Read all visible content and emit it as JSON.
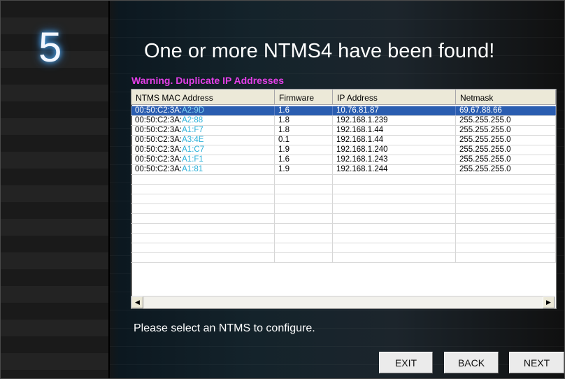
{
  "step": {
    "number": "5"
  },
  "header": {
    "title": "One or more NTMS4 have been found!",
    "warning": "Warning. Duplicate IP Addresses"
  },
  "device_list": {
    "columns": [
      "NTMS MAC Address",
      "Firmware",
      "IP Address",
      "Netmask"
    ],
    "rows": [
      {
        "mac_prefix": "00:50:C2:3A:",
        "mac_suffix": "A2:9D",
        "firmware": "1.6",
        "ip": "10.76.81.87",
        "netmask": "69.67.88.66",
        "selected": true
      },
      {
        "mac_prefix": "00:50:C2:3A:",
        "mac_suffix": "A2:88",
        "firmware": "1.8",
        "ip": "192.168.1.239",
        "netmask": "255.255.255.0",
        "selected": false
      },
      {
        "mac_prefix": "00:50:C2:3A:",
        "mac_suffix": "A1:F7",
        "firmware": "1.8",
        "ip": "192.168.1.44",
        "netmask": "255.255.255.0",
        "selected": false
      },
      {
        "mac_prefix": "00:50:C2:3A:",
        "mac_suffix": "A3:4E",
        "firmware": "0.1",
        "ip": "192.168.1.44",
        "netmask": "255.255.255.0",
        "selected": false
      },
      {
        "mac_prefix": "00:50:C2:3A:",
        "mac_suffix": "A1:C7",
        "firmware": "1.9",
        "ip": "192.168.1.240",
        "netmask": "255.255.255.0",
        "selected": false
      },
      {
        "mac_prefix": "00:50:C2:3A:",
        "mac_suffix": "A1:F1",
        "firmware": "1.6",
        "ip": "192.168.1.243",
        "netmask": "255.255.255.0",
        "selected": false
      },
      {
        "mac_prefix": "00:50:C2:3A:",
        "mac_suffix": "A1:81",
        "firmware": "1.9",
        "ip": "192.168.1.244",
        "netmask": "255.255.255.0",
        "selected": false
      }
    ],
    "scroll_left_icon": "arrow-left-icon",
    "scroll_right_icon": "arrow-right-icon"
  },
  "prompt": "Please select an NTMS to configure.",
  "buttons": {
    "exit": "EXIT",
    "back": "BACK",
    "next": "NEXT"
  },
  "colors": {
    "warning": "#e43fe8",
    "selection": "#2a5db0",
    "mac_suffix": "#2ab0d8",
    "step_glow": "#58b6ff"
  }
}
